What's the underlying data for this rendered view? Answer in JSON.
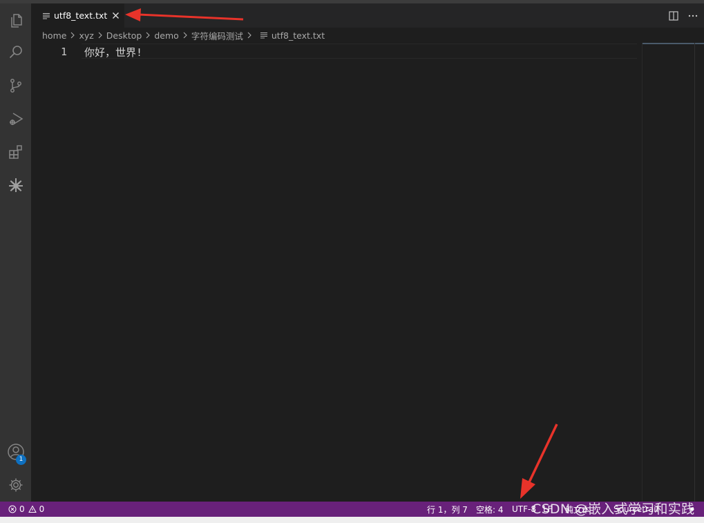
{
  "tab": {
    "label": "utf8_text.txt",
    "icon": "text-file-icon"
  },
  "breadcrumb": [
    "home",
    "xyz",
    "Desktop",
    "demo",
    "字符编码测试",
    "utf8_text.txt"
  ],
  "editor": {
    "lines": [
      {
        "number": "1",
        "text": "你好，世界!"
      }
    ]
  },
  "activity_bar": {
    "items": [
      "explorer-icon",
      "search-icon",
      "source-control-icon",
      "run-debug-icon",
      "extensions-icon",
      "sourcetrail-icon"
    ],
    "bottom": [
      "account-icon",
      "settings-gear-icon"
    ],
    "account_badge": "1"
  },
  "status_bar": {
    "errors": "0",
    "warnings": "0",
    "position": "行 1，列 7",
    "indent": "空格: 4",
    "encoding": "UTF-8",
    "eol": "LF",
    "language": "纯文本",
    "extension": "Sourcetrail",
    "background": "#68217a"
  },
  "watermark": "CSDN @嵌入式学习和实践",
  "colors": {
    "annotation_arrow": "#e8332a",
    "editor_bg": "#1e1e1e"
  }
}
